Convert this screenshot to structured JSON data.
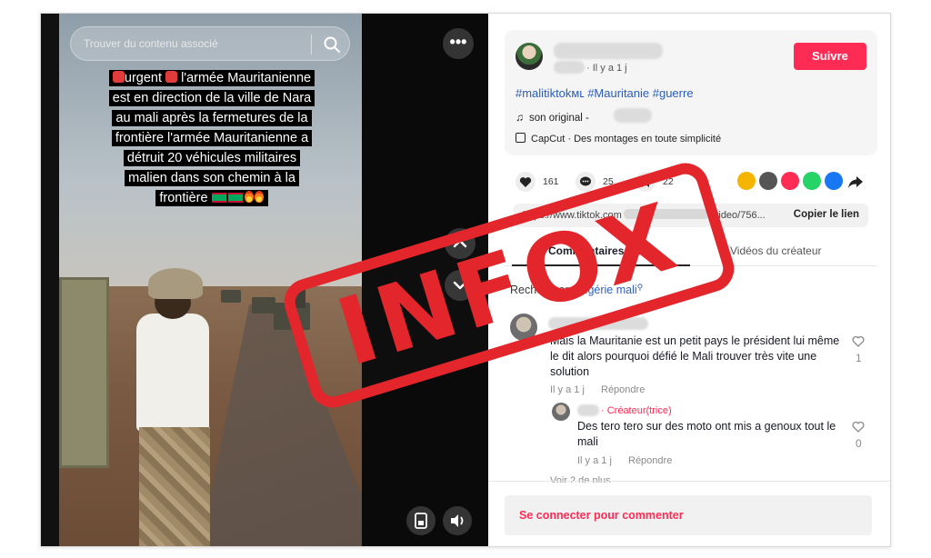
{
  "video": {
    "search_placeholder": "Trouver du contenu associé",
    "caption": {
      "urgent_word": "urgent",
      "lines": [
        "l'armée Mauritanienne",
        "est en direction de la ville de Nara",
        "au mali après la fermetures de la",
        "frontière l'armée Mauritanienne a",
        "détruit 20 véhicules militaires",
        "malien dans son chemin à la",
        "frontière"
      ]
    }
  },
  "post": {
    "time": "· Il y a 1 j",
    "follow_label": "Suivre",
    "hashtags": "#malitiktokᴍʟ #Mauritanie #guerre",
    "sound": "son original -",
    "capcut": "CapCut · Des montages en toute simplicité"
  },
  "stats": {
    "likes": "161",
    "comments": "25",
    "saves": "22"
  },
  "link": {
    "url_start": "https://www.tiktok.com",
    "url_end": "/video/756...",
    "copy_label": "Copier le lien"
  },
  "tabs": {
    "comments": "Commentaires (25)",
    "creator_videos": "Vidéos du créateur"
  },
  "comment_search": {
    "prefix": "Rechercher · ",
    "query": "algérie mali"
  },
  "comments": [
    {
      "text": "Mais la Mauritanie est un petit pays le président lui même le dit alors pourquoi défié le Mali trouver très vite une solution",
      "time": "Il y a 1 j",
      "reply": "Répondre",
      "likes": "1"
    },
    {
      "badge": "· Créateur(trice)",
      "text": "Des tero tero sur des moto ont mis a genoux tout le mali",
      "time": "Il y a 1 j",
      "reply": "Répondre",
      "likes": "0"
    }
  ],
  "more_replies": "Voir 2 de plus",
  "login_prompt": "Se connecter pour commenter",
  "stamp": {
    "text": "INFOX",
    "color": "#e3262b"
  },
  "colors": {
    "accent": "#fe2c55",
    "hashtag": "#2b5db8"
  }
}
